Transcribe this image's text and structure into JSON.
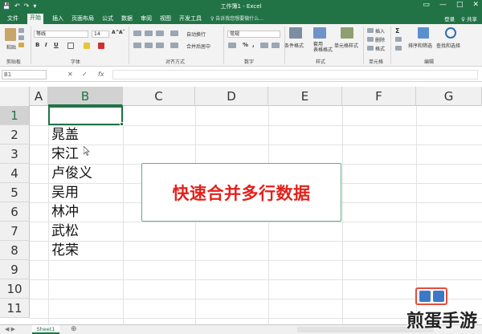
{
  "titlebar": {
    "title": "工作簿1 - Excel",
    "quick_access": [
      "💾",
      "↶",
      "↷",
      "▾"
    ],
    "window_controls": [
      "▭",
      "—",
      "□",
      "✕"
    ]
  },
  "tabs": {
    "items": [
      "文件",
      "开始",
      "插入",
      "页面布局",
      "公式",
      "数据",
      "审阅",
      "视图",
      "开发工具"
    ],
    "active": "开始",
    "search_hint": "♀ 告诉我您想要做什么...",
    "login": "登录",
    "share": "♀ 共享"
  },
  "ribbon": {
    "clipboard": {
      "paste": "粘贴",
      "label": "剪贴板"
    },
    "font": {
      "name": "等线",
      "size": "14",
      "label": "字体",
      "bold": "B",
      "italic": "I",
      "underline": "U"
    },
    "alignment": {
      "wrap": "自动换行",
      "merge": "合并后居中",
      "label": "对齐方式"
    },
    "number": {
      "format": "常规",
      "label": "数字",
      "percent": "%",
      "comma": ","
    },
    "styles": {
      "conditional": "条件格式",
      "table": "套用\n表格格式",
      "cell": "单元格样式",
      "label": "样式"
    },
    "cells": {
      "insert": "插入",
      "delete": "删除",
      "format": "格式",
      "label": "单元格"
    },
    "editing": {
      "sort": "排序和筛选",
      "find": "查找和选择",
      "label": "编辑"
    }
  },
  "formula_bar": {
    "name_box": "B1",
    "cancel": "✕",
    "confirm": "✓",
    "fx": "fx",
    "value": ""
  },
  "grid": {
    "columns": [
      "A",
      "B",
      "C",
      "D",
      "E",
      "F",
      "G"
    ],
    "selected_column": "B",
    "rows": [
      "1",
      "2",
      "3",
      "4",
      "5",
      "6",
      "7",
      "8",
      "9",
      "10",
      "11"
    ],
    "selected_row": "1",
    "active_cell": "B1",
    "column_b_values": [
      "",
      "晁盖",
      "宋江",
      "卢俊义",
      "吴用",
      "林冲",
      "武松",
      "花荣",
      "",
      "",
      ""
    ]
  },
  "callout": {
    "text": "快速合并多行数据"
  },
  "sheets": {
    "tabs": [
      "Sheet1"
    ],
    "add": "⊕",
    "nav": "◀ ▶"
  },
  "watermark": "煎蛋手游",
  "colors": {
    "accent": "#217346",
    "callout_text": "#e3211b",
    "callout_border": "#5fae86"
  }
}
